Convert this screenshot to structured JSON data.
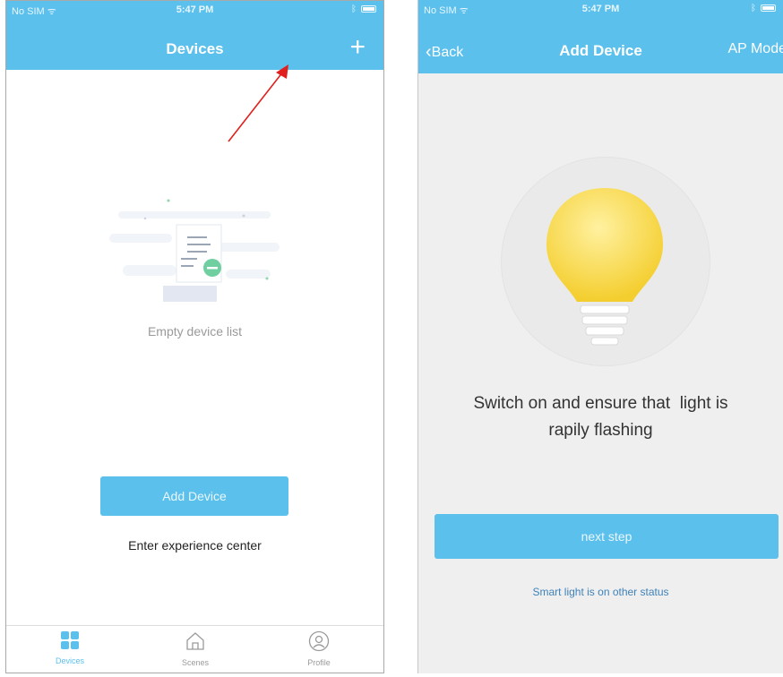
{
  "left_screen": {
    "status": {
      "carrier": "No SIM ᯤ",
      "time": "5:47 PM"
    },
    "header": {
      "title": "Devices",
      "add_icon": "+"
    },
    "empty_state": {
      "label": "Empty device list"
    },
    "add_device_button": "Add Device",
    "experience_link": "Enter experience center",
    "tabs": [
      {
        "label": "Devices",
        "icon": "grid-icon",
        "active": true
      },
      {
        "label": "Scenes",
        "icon": "home-icon",
        "active": false
      },
      {
        "label": "Profile",
        "icon": "profile-icon",
        "active": false
      }
    ],
    "colors": {
      "primary": "#5bc0ec",
      "annotation": "#e0201c"
    }
  },
  "right_screen": {
    "status": {
      "carrier": "No SIM ᯤ",
      "time": "5:47 PM"
    },
    "header": {
      "back": "Back",
      "title": "Add Device",
      "right_action": "AP Mode"
    },
    "instruction_line1": "Switch on and ensure that  light is",
    "instruction_line2": "rapily flashing",
    "next_button": "next step",
    "other_status_link": "Smart light is on other status",
    "colors": {
      "bulb": "#f7d84a",
      "link": "#3f82b8"
    }
  }
}
